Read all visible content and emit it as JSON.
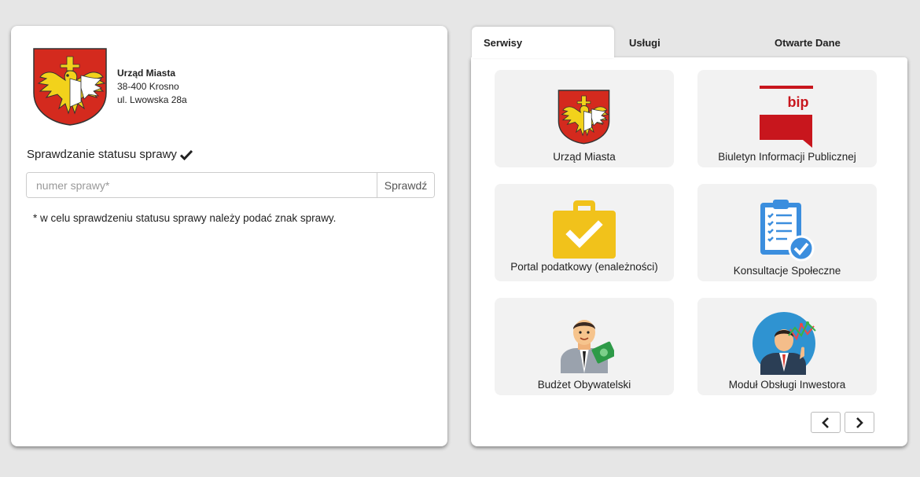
{
  "office": {
    "name": "Urząd Miasta",
    "postal": "38-400 Krosno",
    "street": "ul. Lwowska 28a"
  },
  "status": {
    "title": "Sprawdzanie statusu sprawy",
    "placeholder": "numer sprawy*",
    "button_label": "Sprawdź",
    "note": "* w celu sprawdzeniu statusu sprawy należy podać znak sprawy."
  },
  "tabs": [
    {
      "label": "Serwisy",
      "active": true
    },
    {
      "label": "Usługi",
      "active": false
    },
    {
      "label": "Otwarte Dane",
      "active": false
    }
  ],
  "services": [
    {
      "label": "Urząd Miasta",
      "icon": "crest-icon"
    },
    {
      "label": "Biuletyn Informacji Publicznej",
      "icon": "bip-icon",
      "icon_text": "bip"
    },
    {
      "label": "Portal podatkowy (enależności)",
      "icon": "briefcase-check-icon"
    },
    {
      "label": "Konsultacje Społeczne",
      "icon": "clipboard-check-icon"
    },
    {
      "label": "Budżet Obywatelski",
      "icon": "person-money-icon"
    },
    {
      "label": "Moduł Obsługi Inwestora",
      "icon": "investor-chart-icon"
    }
  ],
  "colors": {
    "crest_red": "#d42a1e",
    "crest_gold": "#f2d21b",
    "bip_red": "#c8161d",
    "briefcase_yellow": "#f1c21b",
    "clipboard_blue": "#3b8ede",
    "background": "#e6e6e6"
  }
}
